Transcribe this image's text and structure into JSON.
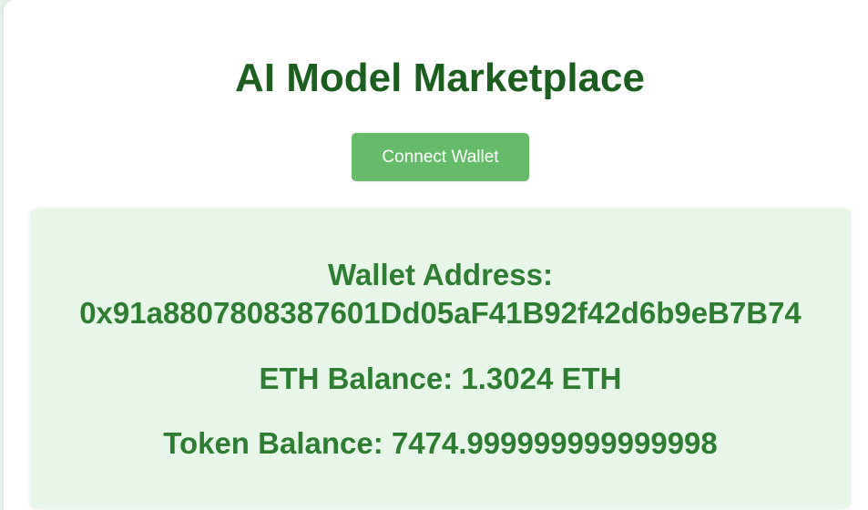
{
  "header": {
    "title": "AI Model Marketplace",
    "connect_label": "Connect Wallet"
  },
  "wallet": {
    "address_label": "Wallet Address:",
    "address_value": "0x91a8807808387601Dd05aF41B92f42d6b9eB7B74",
    "eth_label": "ETH Balance:",
    "eth_value": "1.3024 ETH",
    "token_label": "Token Balance:",
    "token_value": "7474.999999999999998"
  },
  "colors": {
    "title": "#1b5e20",
    "button_bg": "#66bb6a",
    "card_bg": "#e8f5e9",
    "card_text": "#2e7d32"
  }
}
